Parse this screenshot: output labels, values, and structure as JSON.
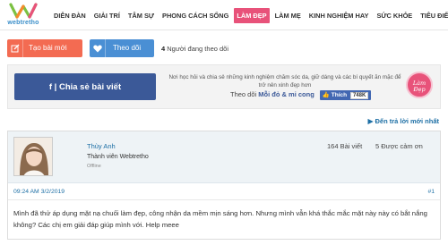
{
  "logo": {
    "text": "webtretho"
  },
  "nav": {
    "items": [
      {
        "label": "DIỄN ĐÀN"
      },
      {
        "label": "GIẢI TRÍ"
      },
      {
        "label": "TÂM SỰ"
      },
      {
        "label": "PHONG CÁCH SỐNG"
      },
      {
        "label": "LÀM ĐẸP"
      },
      {
        "label": "LÀM MẸ"
      },
      {
        "label": "KINH NGHIỆM HAY"
      },
      {
        "label": "SỨC KHỎE"
      },
      {
        "label": "TIÊU ĐIỂM"
      }
    ],
    "active_label": "LÀM ĐẸP"
  },
  "actions": {
    "new_post_label": "Tạo bài mới",
    "follow_label": "Theo dõi",
    "follower_count": "4",
    "follower_text": "Người đang theo dõi"
  },
  "share": {
    "button_label": "f | Chia sẻ bài viết",
    "description": "Nơi học hỏi và chia sẻ những kinh nghiệm chăm sóc da, giữ dáng và các bí quyết ăn mặc để trở nên xinh đẹp hơn",
    "fb_prefix": "Theo dõi",
    "fb_page": "Mỗi đỏ & mi cong",
    "like_label": "Thích",
    "like_count": "748K",
    "badge_text": "Làm Đẹp"
  },
  "thread": {
    "last_reply_label": "Đến trả lời mới nhất"
  },
  "post": {
    "username": "Thùy Anh",
    "role": "Thành viên Webtretho",
    "status": "Offline",
    "posts_count": "164 Bài viết",
    "thanks_count": "5 Được cảm ơn",
    "time": "09:24 AM 3/2/2019",
    "number": "#1",
    "content": "Mình đã thử áp dụng mặt nạ chuối làm đẹp, công nhận da mềm mịn sáng hơn. Nhưng mình vẫn khá thắc mắc mặt này này có bắt nắng không? Các chị em giải đáp giúp mình với. Help meee"
  },
  "colors": {
    "accent_pink": "#e8527a",
    "new_post_orange": "#f36b52",
    "follow_blue": "#4a8fd4",
    "facebook_blue": "#3b5998",
    "link_blue": "#1d6fa5"
  },
  "icons": {
    "new_post": "pencil-square-icon",
    "follow": "heart-icon",
    "last_reply": "triangle-right-icon"
  }
}
